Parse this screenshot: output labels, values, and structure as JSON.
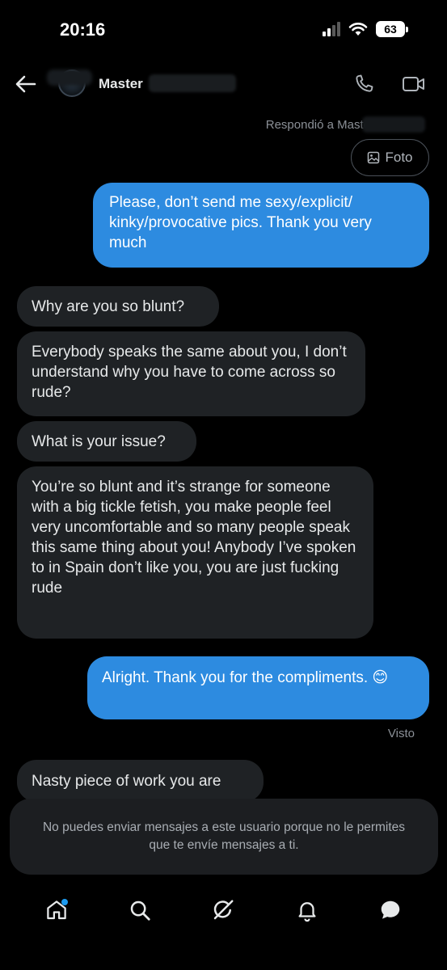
{
  "status": {
    "time": "20:16",
    "battery": "63"
  },
  "header": {
    "contact_name": "Master"
  },
  "thread": {
    "replied_label": "Respondió a Master",
    "photo_chip": "Foto",
    "seen_label": "Visto",
    "messages": [
      {
        "side": "out",
        "text": "Please, don’t send me sexy/explicit/ kinky/provocative pics. Thank you very much"
      },
      {
        "side": "in",
        "text": "Why are you so blunt?"
      },
      {
        "side": "in",
        "text": "Everybody speaks the same about you, I don’t understand why you have to come across so rude?"
      },
      {
        "side": "in",
        "text": "What is your issue?"
      },
      {
        "side": "in",
        "text": "You’re so blunt and it’s strange for someone with a big tickle fetish, you make people feel very uncomfortable and so many people speak this same thing about you! Anybody I’ve spoken to in Spain don’t like you, you are just fucking rude"
      },
      {
        "side": "out",
        "text": "Alright. Thank you for the compliments. 😊"
      },
      {
        "side": "in",
        "text": "Nasty piece of work you are"
      }
    ]
  },
  "notice": {
    "text": "No puedes enviar mensajes a este usuario porque no le permites que te envíe mensajes a ti."
  },
  "icons": {
    "back": "back-arrow-icon",
    "call": "phone-icon",
    "video": "video-camera-icon",
    "photo": "image-icon",
    "home": "home-icon",
    "search": "search-icon",
    "grok": "grok-icon",
    "notifications": "bell-icon",
    "messages": "message-bubble-icon"
  },
  "colors": {
    "outgoing_bubble": "#2d8be0",
    "incoming_bubble": "#1f2225",
    "accent": "#1d9bf0"
  }
}
